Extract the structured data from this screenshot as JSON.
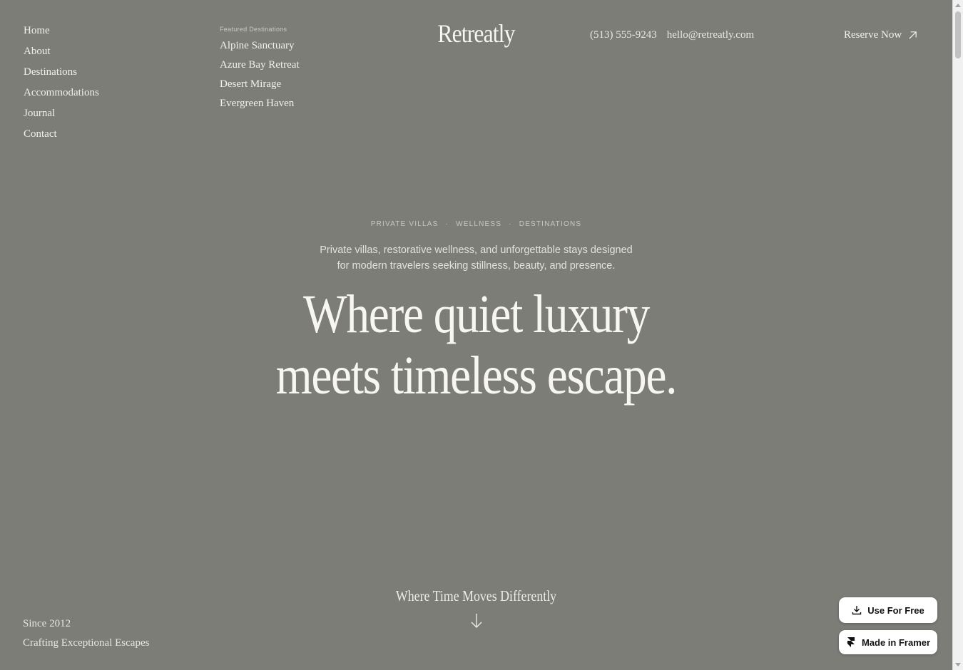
{
  "nav": {
    "items": [
      "Home",
      "About",
      "Destinations",
      "Accommodations",
      "Journal",
      "Contact"
    ]
  },
  "featured": {
    "label": "Featured Destinations",
    "items": [
      "Alpine Sanctuary",
      "Azure Bay Retreat",
      "Desert Mirage",
      "Evergreen Haven"
    ]
  },
  "brand": {
    "logo": "Retreatly"
  },
  "contact": {
    "phone": "(513) 555-9243",
    "email": "hello@retreatly.com"
  },
  "cta": {
    "reserve_label": "Reserve Now",
    "icon": "arrow-up-right-icon"
  },
  "hero": {
    "tags": [
      "PRIVATE VILLAS",
      "WELLNESS",
      "DESTINATIONS"
    ],
    "intro_line1": "Private villas, restorative wellness, and unforgettable stays designed",
    "intro_line2": "for modern travelers seeking stillness, beauty, and presence.",
    "headline_line1": "Where quiet luxury",
    "headline_line2": "meets timeless escape."
  },
  "footer": {
    "tagline": "Where Time Moves Differently",
    "since": "Since 2012",
    "crafting": "Crafting Exceptional Escapes"
  },
  "badges": {
    "use_for_free": "Use For Free",
    "made_in_framer": "Made in Framer"
  },
  "colors": {
    "background": "#7d7d78",
    "text": "#f4f3ef"
  }
}
